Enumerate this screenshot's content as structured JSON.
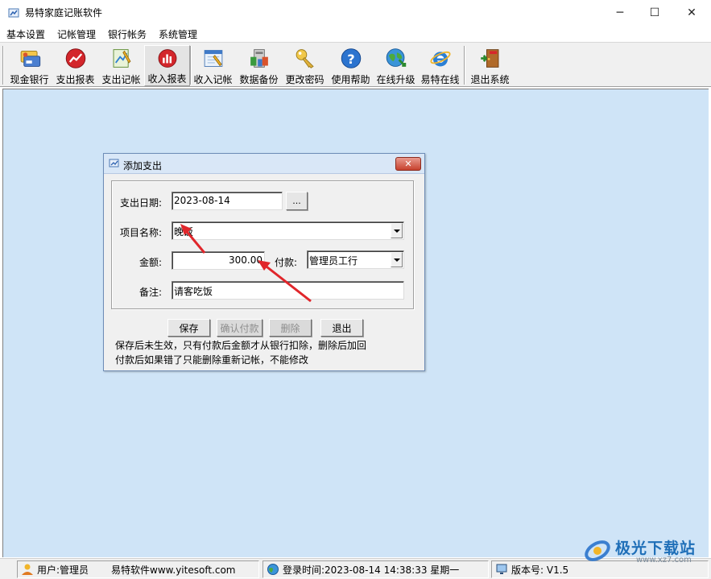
{
  "window": {
    "title": "易特家庭记账软件",
    "minimize_glyph": "─",
    "maximize_glyph": "☐",
    "close_glyph": "✕"
  },
  "menu": [
    "基本设置",
    "记帐管理",
    "银行帐务",
    "系统管理"
  ],
  "toolbar": [
    {
      "label": "现金银行",
      "icon": "cash-bank-icon"
    },
    {
      "label": "支出报表",
      "icon": "expense-report-icon"
    },
    {
      "label": "支出记帐",
      "icon": "expense-entry-icon"
    },
    {
      "label": "收入报表",
      "icon": "income-report-icon"
    },
    {
      "label": "收入记帐",
      "icon": "income-entry-icon"
    },
    {
      "label": "数据备份",
      "icon": "data-backup-icon"
    },
    {
      "label": "更改密码",
      "icon": "change-password-icon"
    },
    {
      "label": "使用帮助",
      "icon": "help-icon"
    },
    {
      "label": "在线升级",
      "icon": "online-upgrade-icon"
    },
    {
      "label": "易特在线",
      "icon": "ie-browser-icon"
    },
    {
      "label": "退出系统",
      "icon": "exit-icon"
    }
  ],
  "dialog": {
    "title": "添加支出",
    "close_glyph": "✕",
    "date_label": "支出日期:",
    "date_value": "2023-08-14",
    "date_picker_label": "...",
    "item_label": "项目名称:",
    "item_value": "晚饭",
    "amount_label": "金额:",
    "amount_value": "300.00",
    "payment_label": "付款:",
    "payment_value": "管理员工行",
    "memo_label": "备注:",
    "memo_value": "请客吃饭",
    "buttons": {
      "save": "保存",
      "confirm_pay": "确认付款",
      "delete": "删除",
      "exit": "退出"
    },
    "note_line1": "保存后未生效，只有付款后金额才从银行扣除，删除后加回",
    "note_line2": "付款后如果错了只能删除重新记帐，不能修改"
  },
  "statusbar": {
    "user": "用户:管理员",
    "website": "易特软件www.yitesoft.com",
    "login_time": "登录时间:2023-08-14 14:38:33 星期一",
    "version": "版本号: V1.5"
  },
  "watermark": {
    "text": "极光下载站",
    "sub": "www.xz7.com"
  },
  "colors": {
    "workarea": "#cfe4f7",
    "annotation_arrow": "#e0262b"
  }
}
